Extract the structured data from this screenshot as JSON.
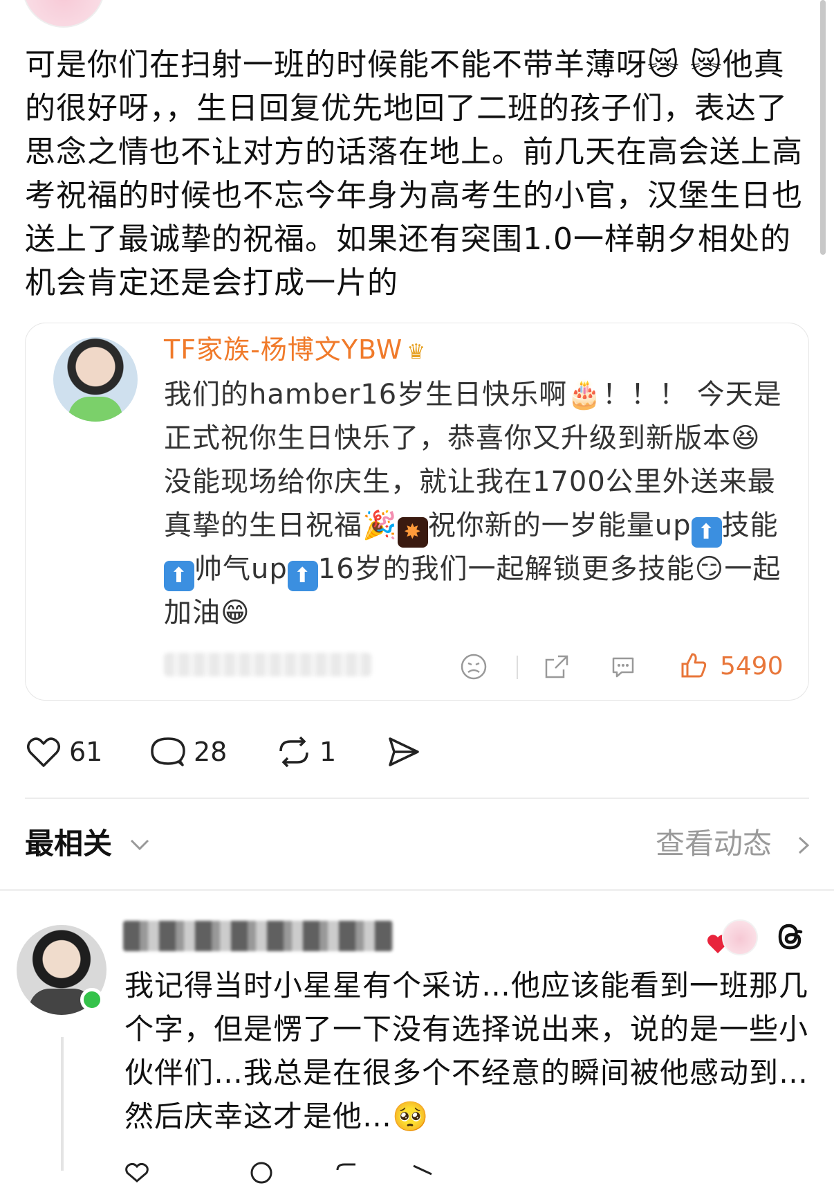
{
  "post": {
    "line1": "可是你们在扫射一班的时候能不能不带羊薄呀",
    "emoji_crying_cat": "😿",
    "line1_end": "他真",
    "rest": "的很好呀，，生日回复优先地回了二班的孩子们，表达了思念之情也不让对方的话落在地上。前几天在高会送上高考祝福的时候也不忘今年身为高考生的小官，汉堡生日也送上了最诚挚的祝福。如果还有突围1.0一样朝夕相处的机会肯定还是会打成一片的"
  },
  "quote": {
    "author": "TF家族-杨博文YBW",
    "crown": "♛",
    "t1": "我们的hamber16岁生日快乐啊",
    "cake": "🎂",
    "t2": "！！！ 今天是正式祝你生日快乐了，恭喜你又升级到新版本",
    "emoji_laugh": "😆",
    "t3": "没能现场给你庆生，就让我在1700公里外送来最真挚的生日祝福",
    "party": "🎉",
    "fireworks": "✸",
    "t4": "祝你新的一岁能量up",
    "up": "⬆",
    "t5": "技能",
    "t6": "帅气up",
    "t7": "16岁的我们一起解锁更多技能",
    "emoji_smirk": "😏",
    "t8": "一起加油",
    "emoji_grin": "😁",
    "likes": "5490"
  },
  "stats": {
    "likes": "61",
    "comments": "28",
    "reposts": "1"
  },
  "sort": {
    "label": "最相关",
    "activity": "查看动态"
  },
  "comment": {
    "text": "我记得当时小星星有个采访…他应该能看到一班那几个字，但是愣了一下没有选择说出来，说的是一些小伙伴们…我总是在很多个不经意的瞬间被他感动到…然后庆幸这才是他…",
    "emoji_pleading": "🥺"
  },
  "colors": {
    "accent_orange": "#f07a2a",
    "like_orange": "#e8763a",
    "online_green": "#34c24a"
  }
}
